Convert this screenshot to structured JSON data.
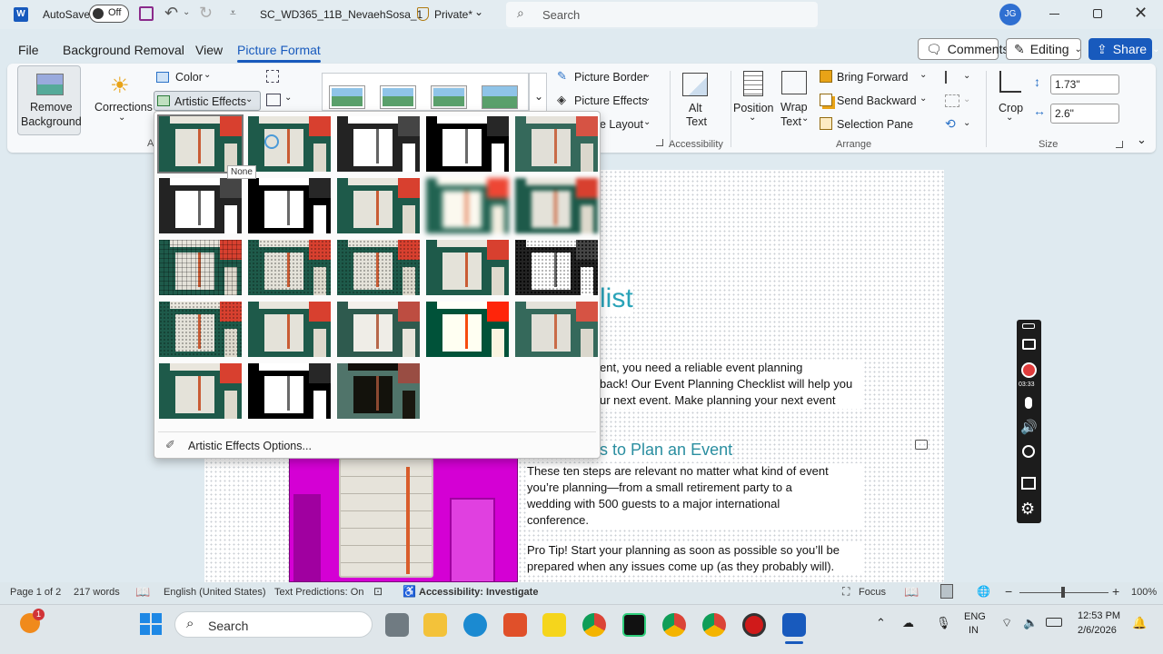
{
  "titlebar": {
    "autosave_label": "AutoSave",
    "autosave_state": "Off",
    "doc_name": "SC_WD365_11B_NevaehSosa_1",
    "privacy": "Private*",
    "search_placeholder": "Search",
    "user_initials": "JG"
  },
  "menu": {
    "tabs": [
      "File",
      "Background Removal",
      "View",
      "Picture Format"
    ],
    "active_tab": "Picture Format",
    "comments": "Comments",
    "editing": "Editing",
    "share": "Share"
  },
  "ribbon": {
    "remove_bg_1": "Remove",
    "remove_bg_2": "Background",
    "corrections": "Corrections",
    "color": "Color",
    "artistic_effects": "Artistic Effects",
    "picture_border": "Picture Border",
    "picture_effects": "Picture Effects",
    "picture_layout": "e Layout",
    "alt_text_1": "Alt",
    "alt_text_2": "Text",
    "accessibility": "Accessibility",
    "position": "Position",
    "wrap_1": "Wrap",
    "wrap_2": "Text",
    "bring_forward": "Bring Forward",
    "send_backward": "Send Backward",
    "selection_pane": "Selection Pane",
    "arrange": "Arrange",
    "crop": "Crop",
    "height": "1.73\"",
    "width": "2.6\"",
    "size": "Size",
    "adjust_short": "A"
  },
  "gallery": {
    "tooltip": "None",
    "options_label": "Artistic Effects Options..."
  },
  "document": {
    "heading_fragment": "list",
    "para1_line1": "ent, you need a reliable event planning",
    "para1_line2": "back! Our Event Planning Checklist will help you",
    "para1_line3": "ur next event. Make planning your next event",
    "heading2": "s to Plan an Event",
    "para2_line1": "These ten steps are relevant no matter what kind of event",
    "para2_line2": "you’re planning—from a small retirement party to a",
    "para2_line3": "wedding with 500 guests to a major international",
    "para2_line4": "conference.",
    "para3_line1": "Pro Tip! Start your planning as soon as possible so you’ll be",
    "para3_line2": "prepared when any issues come up (as they probably will)."
  },
  "recorder": {
    "timer": "03:33"
  },
  "statusbar": {
    "page": "Page 1 of 2",
    "words": "217 words",
    "language": "English (United States)",
    "predictions": "Text Predictions: On",
    "accessibility": "Accessibility: Investigate",
    "focus": "Focus",
    "zoom": "100%"
  },
  "taskbar": {
    "search": "Search",
    "lang1": "ENG",
    "lang2": "IN",
    "time": "12:53 PM",
    "date": "2/6/2026",
    "badge": "1"
  },
  "colors": {
    "accent": "#185abd",
    "heading_teal": "#2aa3b8",
    "magenta": "#d400d4"
  }
}
